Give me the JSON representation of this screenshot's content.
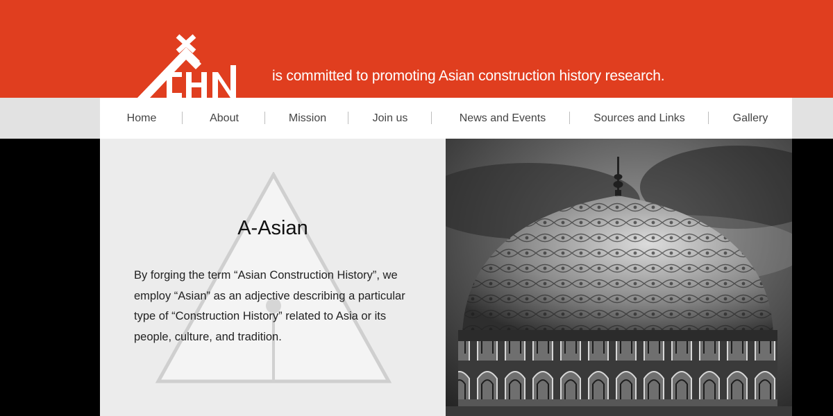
{
  "brand": {
    "logo_text": "ACHN",
    "tagline": "is committed to promoting Asian construction history research."
  },
  "nav": {
    "items": [
      {
        "label": "Home"
      },
      {
        "label": "About"
      },
      {
        "label": "Mission"
      },
      {
        "label": "Join us"
      },
      {
        "label": "News and Events"
      },
      {
        "label": "Sources and Links"
      },
      {
        "label": "Gallery"
      }
    ]
  },
  "main": {
    "heading": "A-Asian",
    "body": "By forging the term “Asian Construction History”, we employ “Asian” as an adjective describing a particular type of “Construction History” related to Asia or its people, culture, and tradition."
  },
  "colors": {
    "header_bg": "#e03e1f",
    "nav_bg": "#ffffff",
    "content_bg": "#ececec"
  }
}
